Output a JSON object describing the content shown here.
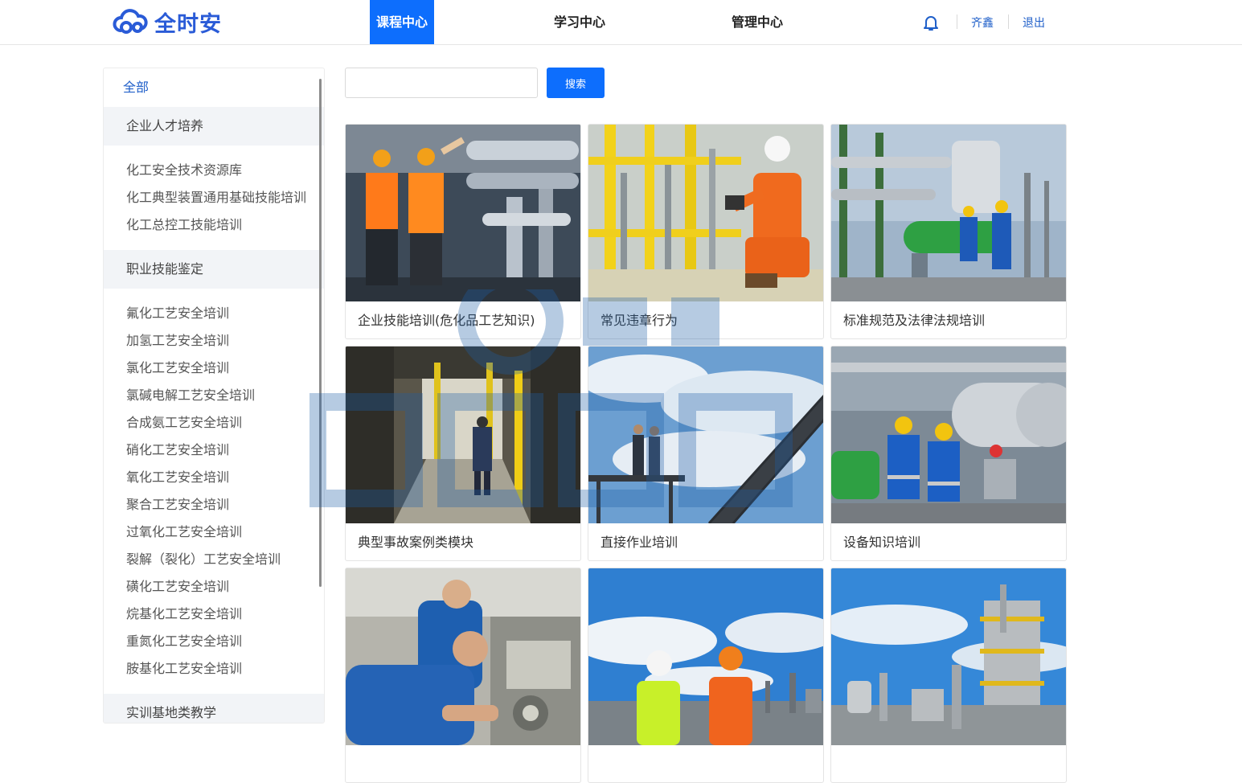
{
  "header": {
    "logo_text": "全时安",
    "nav": [
      {
        "label": "课程中心",
        "active": true
      },
      {
        "label": "学习中心",
        "active": false
      },
      {
        "label": "管理中心",
        "active": false
      }
    ],
    "user_name": "齐鑫",
    "logout_label": "退出",
    "accent_color": "#0d6efd"
  },
  "search": {
    "value": "",
    "placeholder": "",
    "button_label": "搜索"
  },
  "sidebar": {
    "all_label": "全部",
    "groups": [
      {
        "label": "企业人才培养",
        "items": [
          "化工安全技术资源库",
          "化工典型装置通用基础技能培训",
          "化工总控工技能培训"
        ]
      },
      {
        "label": "职业技能鉴定",
        "items": [
          "氟化工艺安全培训",
          "加氢工艺安全培训",
          "氯化工艺安全培训",
          "氯碱电解工艺安全培训",
          "合成氨工艺安全培训",
          "硝化工艺安全培训",
          "氧化工艺安全培训",
          "聚合工艺安全培训",
          "过氧化工艺安全培训",
          "裂解（裂化）工艺安全培训",
          "磺化工艺安全培训",
          "烷基化工艺安全培训",
          "重氮化工艺安全培训",
          "胺基化工艺安全培训"
        ]
      },
      {
        "label": "实训基地类教学",
        "items": []
      }
    ]
  },
  "courses": [
    {
      "title": "企业技能培训(危化品工艺知识)",
      "image": "workers-inspecting-pipes-photo"
    },
    {
      "title": "常见违章行为",
      "image": "worker-orange-suit-tablet-photo"
    },
    {
      "title": "标准规范及法律法规培训",
      "image": "workers-green-pipes-photo"
    },
    {
      "title": "典型事故案例类模块",
      "image": "worker-walking-corridor-photo"
    },
    {
      "title": "直接作业培训",
      "image": "workers-on-steel-stairs-photo"
    },
    {
      "title": "设备知识培训",
      "image": "workers-heat-exchanger-photo"
    },
    {
      "title": "",
      "image": "workers-machine-tool-photo"
    },
    {
      "title": "",
      "image": "workers-refinery-sky-photo"
    },
    {
      "title": "",
      "image": "refinery-tower-photo"
    }
  ]
}
